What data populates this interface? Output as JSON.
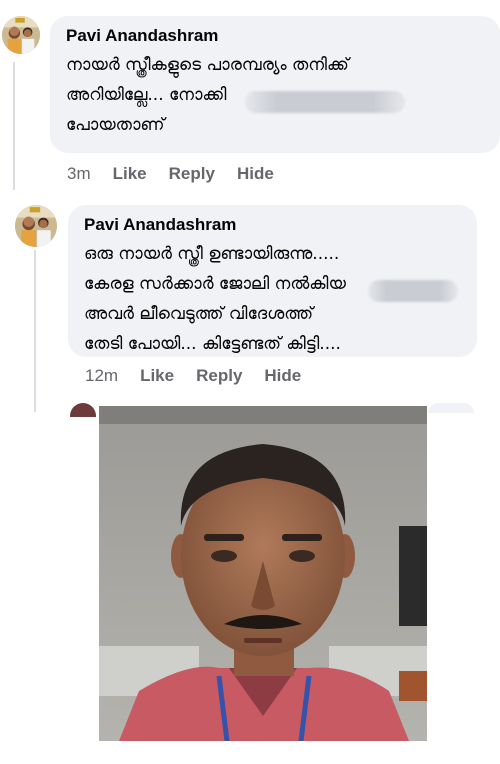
{
  "comments": [
    {
      "author": "Pavi Anandashram",
      "text": "നായർ സ്ത്രീകളുടെ പാരമ്പര്യം തനിക്ക്\nഅറിയില്ലേ...                              നോക്കി\nപോയതാണ്",
      "time": "3m",
      "like_label": "Like",
      "reply_label": "Reply",
      "hide_label": "Hide"
    },
    {
      "author": "Pavi Anandashram",
      "text": "ഒരു നായർ സ്ത്രീ ഉണ്ടായിരുന്നു.....\n കേരള സർക്കാർ ജോലി നൽകിയ\nഅവർ ലീവെടുത്ത് വിദേശത്ത്\nതേടി പോയി... കിട്ടേണ്ടത് കിട്ടി....",
      "time": "12m",
      "like_label": "Like",
      "reply_label": "Reply",
      "hide_label": "Hide"
    }
  ],
  "colors": {
    "bubble": "#f0f2f5",
    "secondary_text": "#65676b",
    "primary_text": "#050505"
  }
}
